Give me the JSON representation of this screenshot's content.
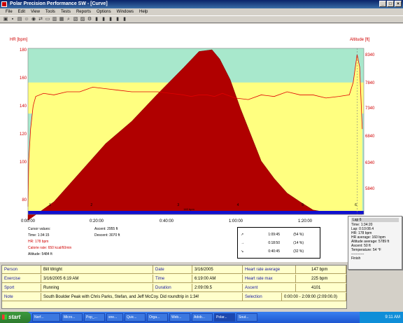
{
  "window": {
    "title": "Polar Precision Performance SW - [Curve]"
  },
  "menu": [
    "File",
    "Edit",
    "View",
    "Tools",
    "Tests",
    "Reports",
    "Options",
    "Windows",
    "Help"
  ],
  "chart_labels": {
    "hr_axis": "HR [bpm]",
    "alt_axis": "Altitude [ft]",
    "hr_ticks": [
      "180",
      "160",
      "140",
      "120",
      "100",
      "80"
    ],
    "alt_ticks": [
      "8340",
      "7840",
      "7340",
      "6840",
      "6340",
      "5840"
    ],
    "time_ticks": [
      "0:00:00",
      "0:20:00",
      "0:40:00",
      "1:00:00",
      "1:20:00"
    ],
    "laps": [
      "1",
      "2",
      "3",
      "4",
      "5",
      "6"
    ],
    "hr_band": "140 bpm"
  },
  "chart_data": {
    "type": "line",
    "xlabel": "",
    "ylabel": "HR [bpm]",
    "y2label": "Altitude [ft]",
    "xlim": [
      0,
      129.6
    ],
    "ylim": [
      75,
      182
    ],
    "y2lim": [
      5584,
      8434
    ],
    "target_zone_bpm": [
      140,
      160
    ],
    "series": [
      {
        "name": "HR",
        "x": [
          0,
          0.3,
          1,
          2,
          3,
          6,
          10,
          15,
          20,
          25,
          30,
          35,
          40,
          45,
          50,
          55,
          60,
          63,
          66,
          69,
          72,
          75,
          80,
          85,
          90,
          95,
          100,
          105,
          110,
          115,
          120,
          124,
          125.5,
          127,
          128,
          129
        ],
        "values": [
          80,
          110,
          130,
          145,
          151,
          153,
          152,
          154,
          154,
          157,
          156,
          155,
          154,
          154,
          154,
          153,
          152,
          151,
          152,
          152,
          151,
          153,
          150,
          149,
          152,
          151,
          154,
          152,
          152,
          150,
          151,
          152,
          160,
          178,
          170,
          130
        ]
      },
      {
        "name": "Altitude",
        "x": [
          0,
          10,
          20,
          30,
          40,
          50,
          60,
          66,
          71,
          74,
          78,
          82,
          86,
          90,
          95,
          100,
          105,
          110,
          115,
          120,
          124,
          127,
          129
        ],
        "values": [
          5484,
          5800,
          6300,
          6800,
          7180,
          7650,
          8100,
          8380,
          8410,
          8250,
          7900,
          7400,
          6950,
          6500,
          6200,
          5950,
          5800,
          5660,
          5620,
          5610,
          5600,
          5588,
          5584
        ]
      }
    ]
  },
  "cursor": {
    "header": "Cursor values:",
    "time": "Time: 1:34:15",
    "hr": "HR: 178 bpm",
    "calories": "Calorie rate: 650 kcal/60min",
    "altitude": "Altitude: 5484 ft"
  },
  "ascent": "Ascent: 2955 ft",
  "descent": "Descent: 3070 ft",
  "zones": [
    {
      "time": "1:09:45",
      "pct": "(54 %)"
    },
    {
      "time": "0:18:50",
      "pct": "(14 %)"
    },
    {
      "time": "0:40:45",
      "pct": "(32 %)"
    }
  ],
  "tooltip": {
    "title": "Lap 6",
    "lines": [
      "Time: 1:34:20",
      "Lap: 0:10:08.4",
      "HR: 178 bpm",
      "HR average: 160 bpm",
      "Altitude average: 5789 ft",
      "Ascent: 50 ft",
      "Temperature: 54 °F",
      "-----------",
      "Finish"
    ]
  },
  "summary": {
    "person_label": "Person",
    "person": "Bill Wright",
    "date_label": "Date",
    "date": "3/16/2005",
    "hr_avg_label": "Heart rate average",
    "hr_avg": "147 bpm",
    "exercise_label": "Exercise",
    "exercise": "3/16/2005 6:19 AM",
    "time_label": "Time",
    "time": "6:19:00 AM",
    "hr_max_label": "Heart rate max",
    "hr_max": "225 bpm",
    "sport_label": "Sport",
    "sport": "Running",
    "duration_label": "Duration",
    "duration": "2:09:09.5",
    "ascent_label": "Ascent",
    "ascent": "4101",
    "note_label": "Note",
    "note": "South Boulder Peak with Chris Parks, Stefan, and Jeff McCoy. Did roundtrip in 1:34!",
    "selection_label": "Selection",
    "selection": "0:00:00 - 2:09:00 (2:09:00.0)"
  },
  "taskbar": {
    "start": "start",
    "tasks": [
      "Nerf...",
      "Micro...",
      "Pop_...",
      "sne...",
      "Quic...",
      "Orga...",
      "Web...",
      "Adob...",
      "Polar...",
      "Sout..."
    ],
    "clock": "9:11 AM"
  }
}
